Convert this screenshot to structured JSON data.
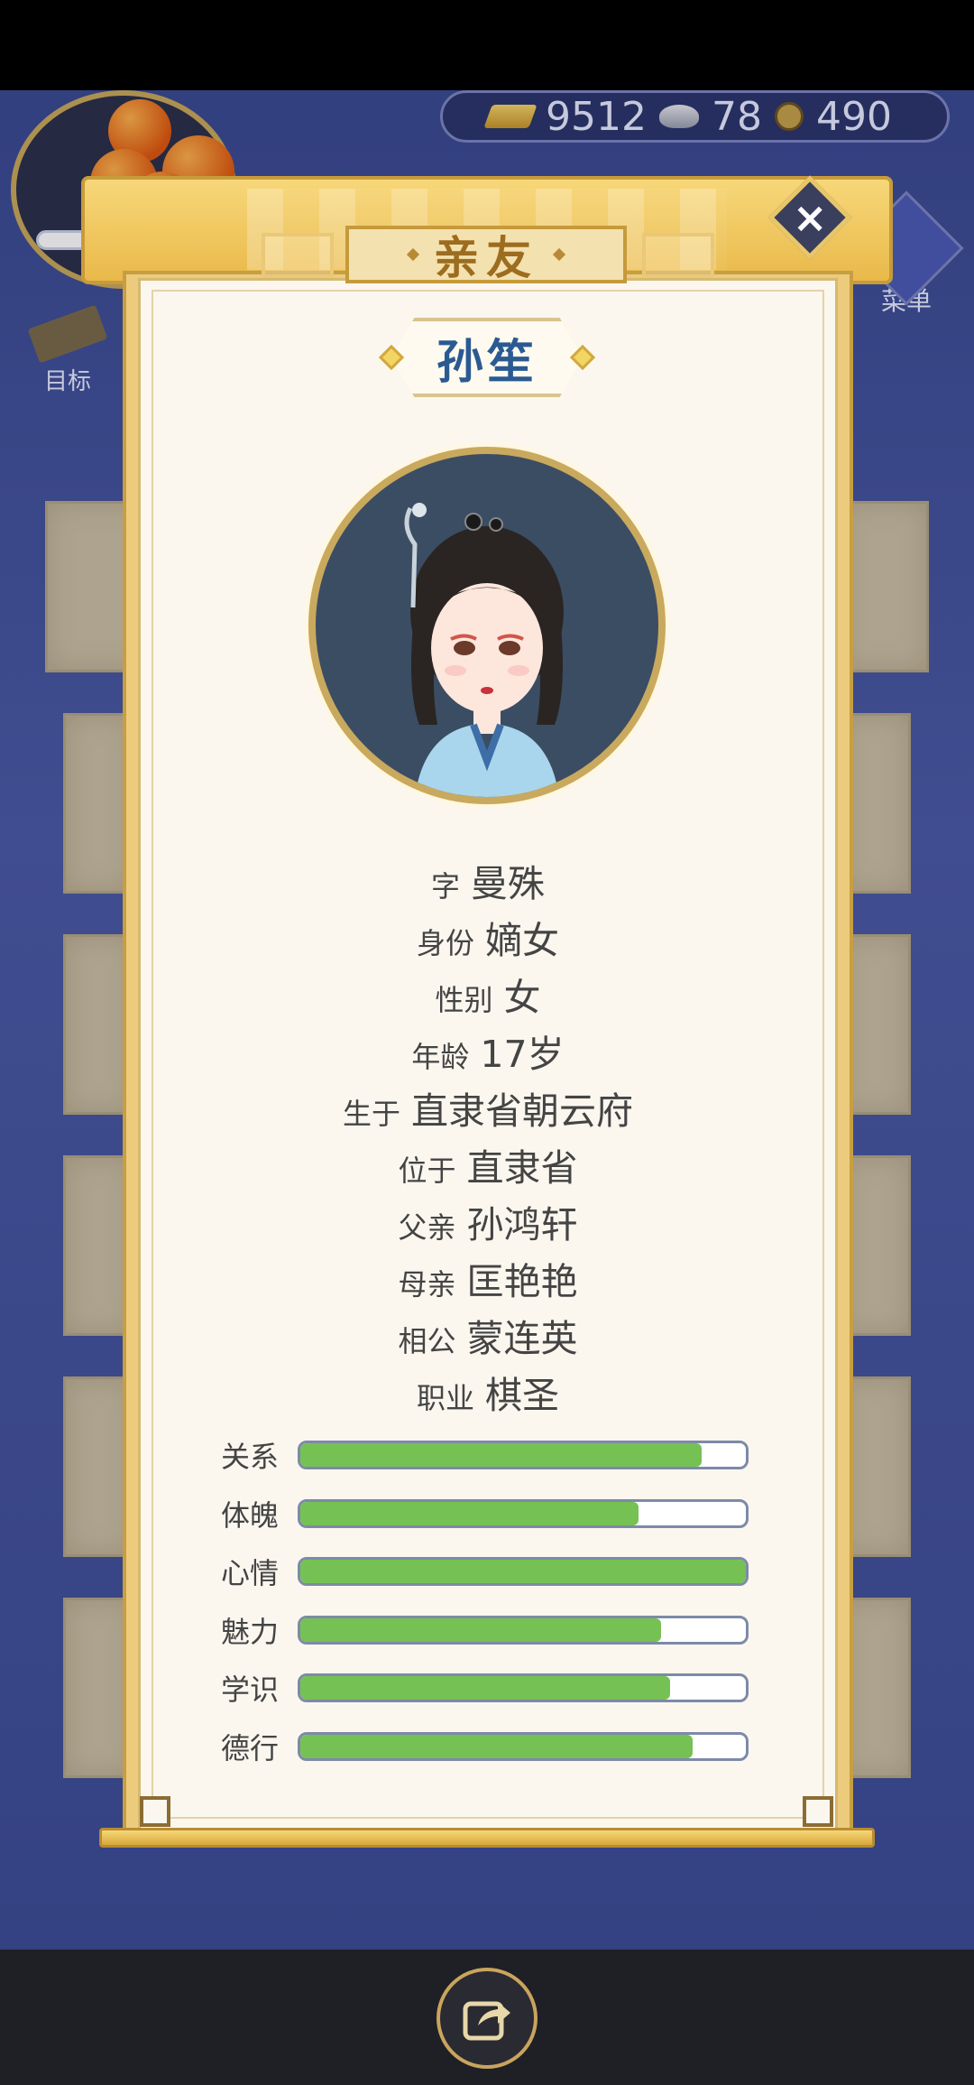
{
  "hud": {
    "resources": {
      "gold": "9512",
      "silver": "78",
      "coins": "490"
    },
    "goal_label": "目标",
    "menu_label": "菜单"
  },
  "dialog": {
    "title": "亲友",
    "name": "孙笙",
    "info": [
      {
        "label": "字",
        "value": "曼殊"
      },
      {
        "label": "身份",
        "value": "嫡女"
      },
      {
        "label": "性别",
        "value": "女"
      },
      {
        "label": "年龄",
        "value": "17岁"
      },
      {
        "label": "生于",
        "value": "直隶省朝云府"
      },
      {
        "label": "位于",
        "value": "直隶省"
      },
      {
        "label": "父亲",
        "value": "孙鸿轩"
      },
      {
        "label": "母亲",
        "value": "匡艳艳"
      },
      {
        "label": "相公",
        "value": "蒙连英"
      },
      {
        "label": "职业",
        "value": "棋圣"
      }
    ],
    "stats": [
      {
        "label": "关系",
        "fraction": 0.9
      },
      {
        "label": "体魄",
        "fraction": 0.76
      },
      {
        "label": "心情",
        "fraction": 1.0
      },
      {
        "label": "魅力",
        "fraction": 0.81
      },
      {
        "label": "学识",
        "fraction": 0.83
      },
      {
        "label": "德行",
        "fraction": 0.88
      }
    ]
  },
  "colors": {
    "bar_fill": "#75c153",
    "name_text": "#2b5a92",
    "title_text": "#9c6d1e"
  },
  "icons": {
    "close": "close-icon",
    "share": "share-icon"
  }
}
